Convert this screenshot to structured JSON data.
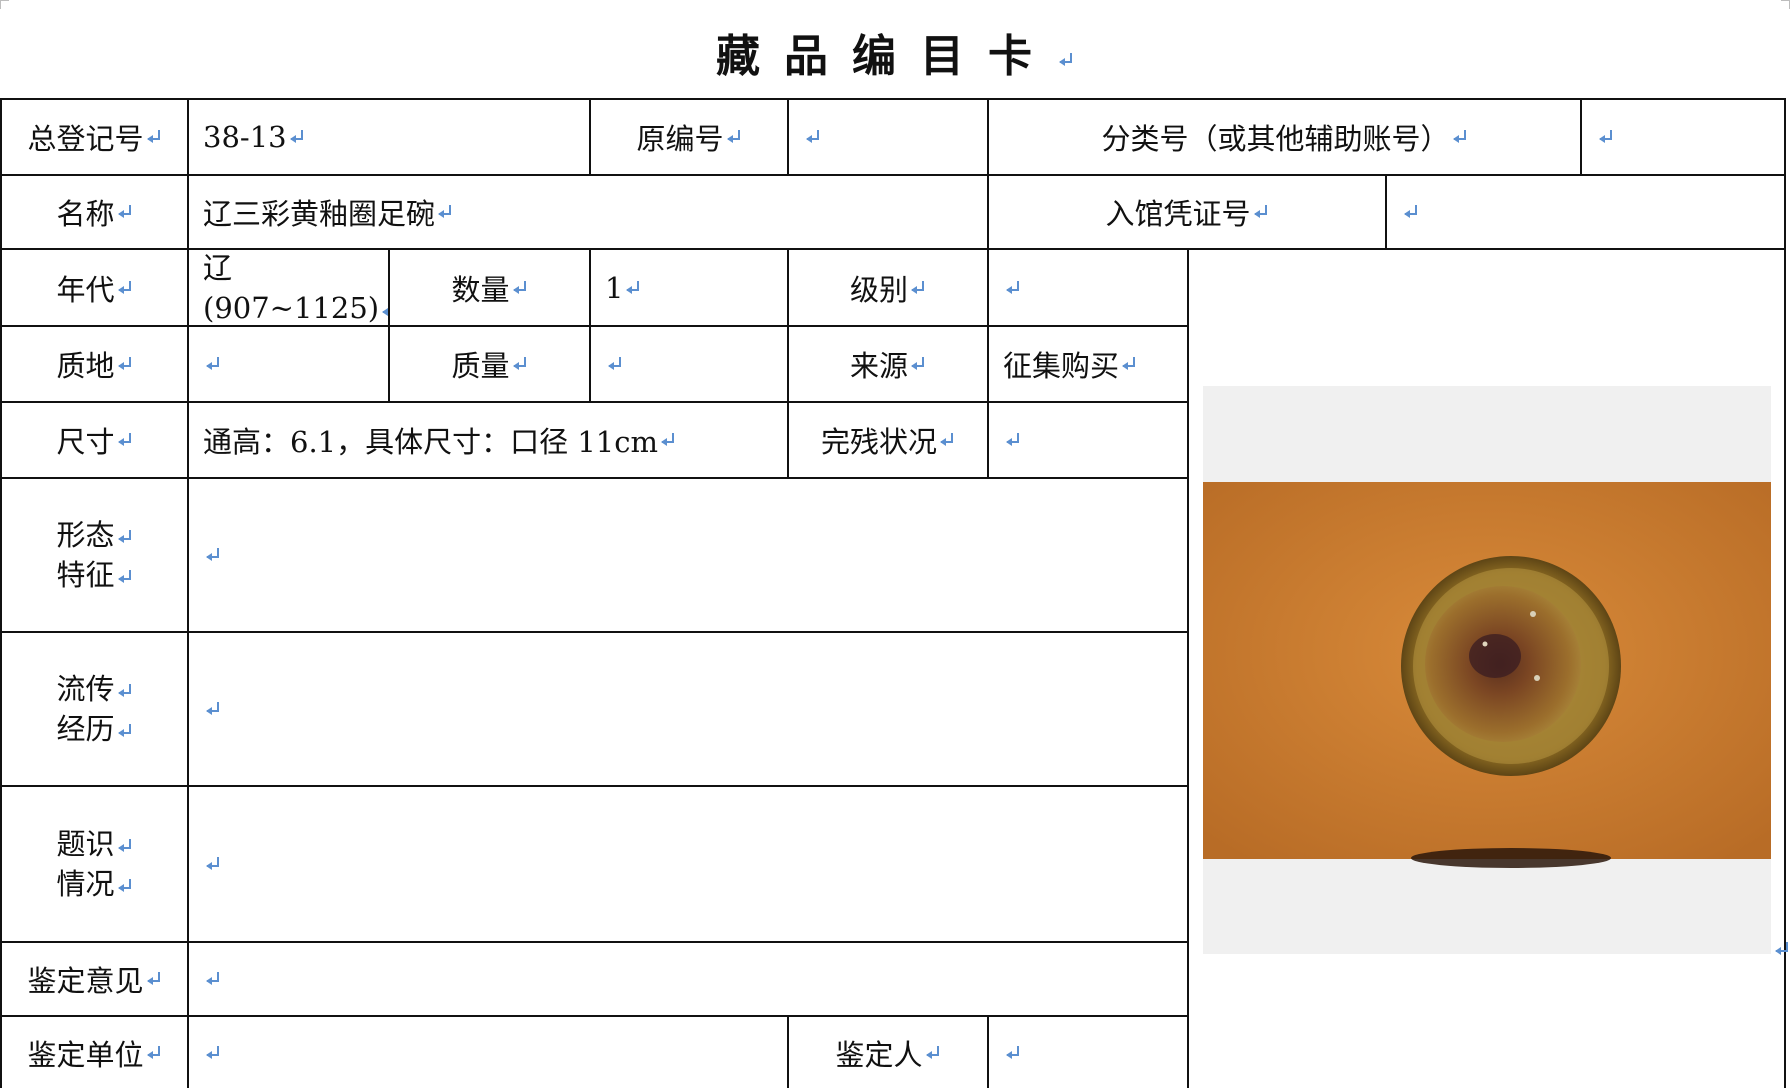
{
  "title": "藏品编目卡",
  "fields": {
    "registration_no_label": "总登记号",
    "registration_no_value": "38-13",
    "original_no_label": "原编号",
    "original_no_value": "",
    "classification_label": "分类号（或其他辅助账号）",
    "classification_value": "",
    "name_label": "名称",
    "name_value": "辽三彩黄釉圈足碗",
    "voucher_label": "入馆凭证号",
    "voucher_value": "",
    "period_label": "年代",
    "period_value_line1": "辽",
    "period_value_line2": "(907~1125)",
    "quantity_label": "数量",
    "quantity_value": "1",
    "grade_label": "级别",
    "grade_value": "",
    "material_label": "质地",
    "material_value": "",
    "weight_label": "质量",
    "weight_value": "",
    "source_label": "来源",
    "source_value": "征集购买",
    "size_label": "尺寸",
    "size_value": "通高：6.1，具体尺寸：口径 11cm",
    "condition_label": "完残状况",
    "condition_value": "",
    "form_label_line1": "形态",
    "form_label_line2": "特征",
    "form_value": "",
    "provenance_label_line1": "流传",
    "provenance_label_line2": "经历",
    "provenance_value": "",
    "inscription_label_line1": "题识",
    "inscription_label_line2": "情况",
    "inscription_value": "",
    "appraisal_opinion_label": "鉴定意见",
    "appraisal_opinion_value": "",
    "appraisal_unit_label": "鉴定单位",
    "appraisal_unit_value": "",
    "appraiser_label": "鉴定人",
    "appraiser_value": ""
  },
  "colors": {
    "border": "#111111",
    "paragraph_mark": "#5b8fd0",
    "photo_background": "#c97a2e",
    "bowl_glaze": "#9c7a2a",
    "bowl_interior": "#7a4a24"
  },
  "icons": {
    "paragraph_mark": "return-arrow-icon"
  }
}
